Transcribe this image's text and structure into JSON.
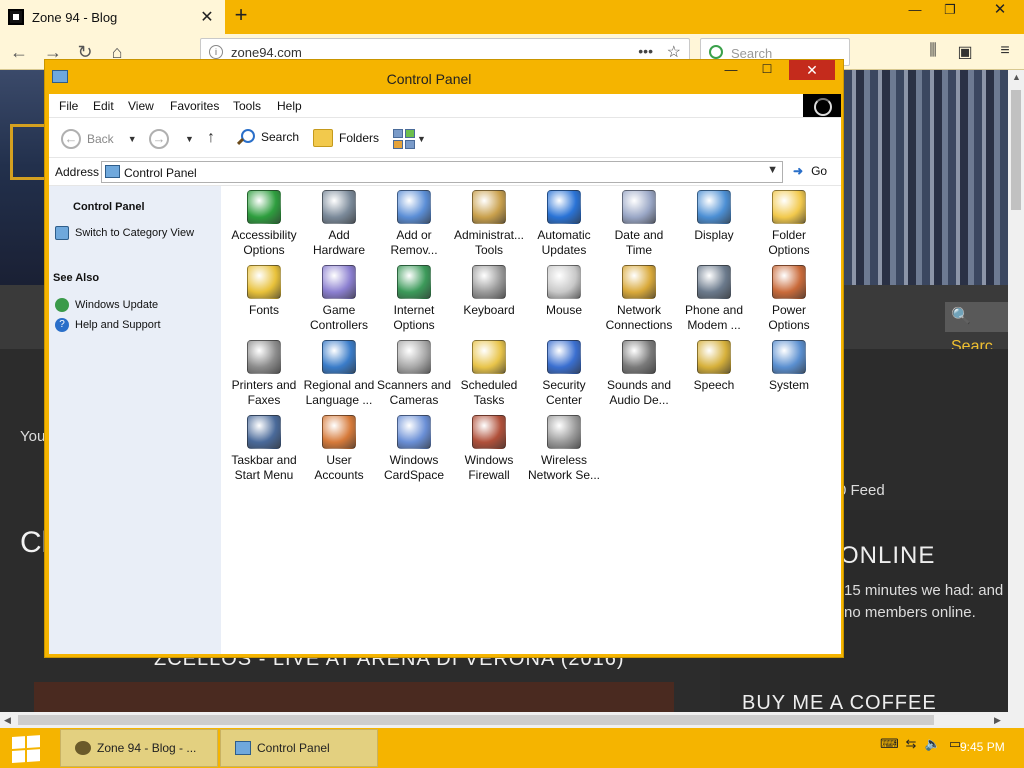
{
  "browser": {
    "tab_title": "Zone 94 - Blog",
    "url": "zone94.com",
    "search_placeholder": "Search"
  },
  "website": {
    "visible_text_you": "You",
    "visible_text_cl": "Cl",
    "rss_text": "0 Feed",
    "online_title": "ONLINE",
    "online_text": "15 minutes we had: and no members online.",
    "post_title": "ZCELLOS - LIVE AT ARENA DI VERONA (2016)",
    "coffee_title": "BUY ME A COFFEE",
    "search_button": "Searc"
  },
  "control_panel": {
    "title": "Control Panel",
    "menu": [
      "File",
      "Edit",
      "View",
      "Favorites",
      "Tools",
      "Help"
    ],
    "toolbar": {
      "back": "Back",
      "search": "Search",
      "folders": "Folders"
    },
    "address_label": "Address",
    "address_value": "Control Panel",
    "go_label": "Go",
    "task_pane": {
      "heading": "Control Panel",
      "switch_view": "Switch to Category View",
      "see_also": "See Also",
      "links": [
        "Windows Update",
        "Help and Support"
      ]
    },
    "items": [
      {
        "label": "Accessibility\nOptions",
        "icon": "accessibility-icon",
        "color": "#2e9e3e"
      },
      {
        "label": "Add\nHardware",
        "icon": "add-hardware-icon",
        "color": "#7b8a9a"
      },
      {
        "label": "Add or\nRemov...",
        "icon": "add-remove-programs-icon",
        "color": "#5b8ed6"
      },
      {
        "label": "Administrat...\nTools",
        "icon": "administrative-tools-icon",
        "color": "#c9a04c"
      },
      {
        "label": "Automatic\nUpdates",
        "icon": "automatic-updates-icon",
        "color": "#2a73d6"
      },
      {
        "label": "Date and\nTime",
        "icon": "date-time-icon",
        "color": "#9aa7c6"
      },
      {
        "label": "Display",
        "icon": "display-icon",
        "color": "#4c8fd4"
      },
      {
        "label": "Folder\nOptions",
        "icon": "folder-options-icon",
        "color": "#f2c94c"
      },
      {
        "label": "Fonts",
        "icon": "fonts-icon",
        "color": "#e8c13a"
      },
      {
        "label": "Game\nControllers",
        "icon": "game-controllers-icon",
        "color": "#8b7fd0"
      },
      {
        "label": "Internet\nOptions",
        "icon": "internet-options-icon",
        "color": "#3c9a5a"
      },
      {
        "label": "Keyboard",
        "icon": "keyboard-icon",
        "color": "#9a9a9a"
      },
      {
        "label": "Mouse",
        "icon": "mouse-icon",
        "color": "#c8c8c8"
      },
      {
        "label": "Network\nConnections",
        "icon": "network-connections-icon",
        "color": "#d9a93a"
      },
      {
        "label": "Phone and\nModem ...",
        "icon": "phone-modem-icon",
        "color": "#6b7a8c"
      },
      {
        "label": "Power\nOptions",
        "icon": "power-options-icon",
        "color": "#c96a3a"
      },
      {
        "label": "Printers and\nFaxes",
        "icon": "printers-faxes-icon",
        "color": "#8c8c8c"
      },
      {
        "label": "Regional and\nLanguage ...",
        "icon": "regional-language-icon",
        "color": "#3a7cc9"
      },
      {
        "label": "Scanners and\nCameras",
        "icon": "scanners-cameras-icon",
        "color": "#a8a8a8"
      },
      {
        "label": "Scheduled\nTasks",
        "icon": "scheduled-tasks-icon",
        "color": "#e8c44a"
      },
      {
        "label": "Security\nCenter",
        "icon": "security-center-icon",
        "color": "#3a6fd0"
      },
      {
        "label": "Sounds and\nAudio De...",
        "icon": "sounds-audio-icon",
        "color": "#7a7a7a"
      },
      {
        "label": "Speech",
        "icon": "speech-icon",
        "color": "#d6b03a"
      },
      {
        "label": "System",
        "icon": "system-icon",
        "color": "#5a8fd0"
      },
      {
        "label": "Taskbar and\nStart Menu",
        "icon": "taskbar-start-menu-icon",
        "color": "#4a6a9a"
      },
      {
        "label": "User\nAccounts",
        "icon": "user-accounts-icon",
        "color": "#d67a3a"
      },
      {
        "label": "Windows\nCardSpace",
        "icon": "windows-cardspace-icon",
        "color": "#6a8fd6"
      },
      {
        "label": "Windows\nFirewall",
        "icon": "windows-firewall-icon",
        "color": "#b0503a"
      },
      {
        "label": "Wireless\nNetwork Se...",
        "icon": "wireless-network-icon",
        "color": "#9a9a9a"
      }
    ]
  },
  "taskbar": {
    "buttons": [
      "Zone 94 - Blog - ...",
      "Control Panel"
    ],
    "clock": "9:45 PM"
  },
  "colors": {
    "accent": "#f5b400",
    "close_red": "#c42b1c",
    "task_pane": "#e9eef7"
  }
}
